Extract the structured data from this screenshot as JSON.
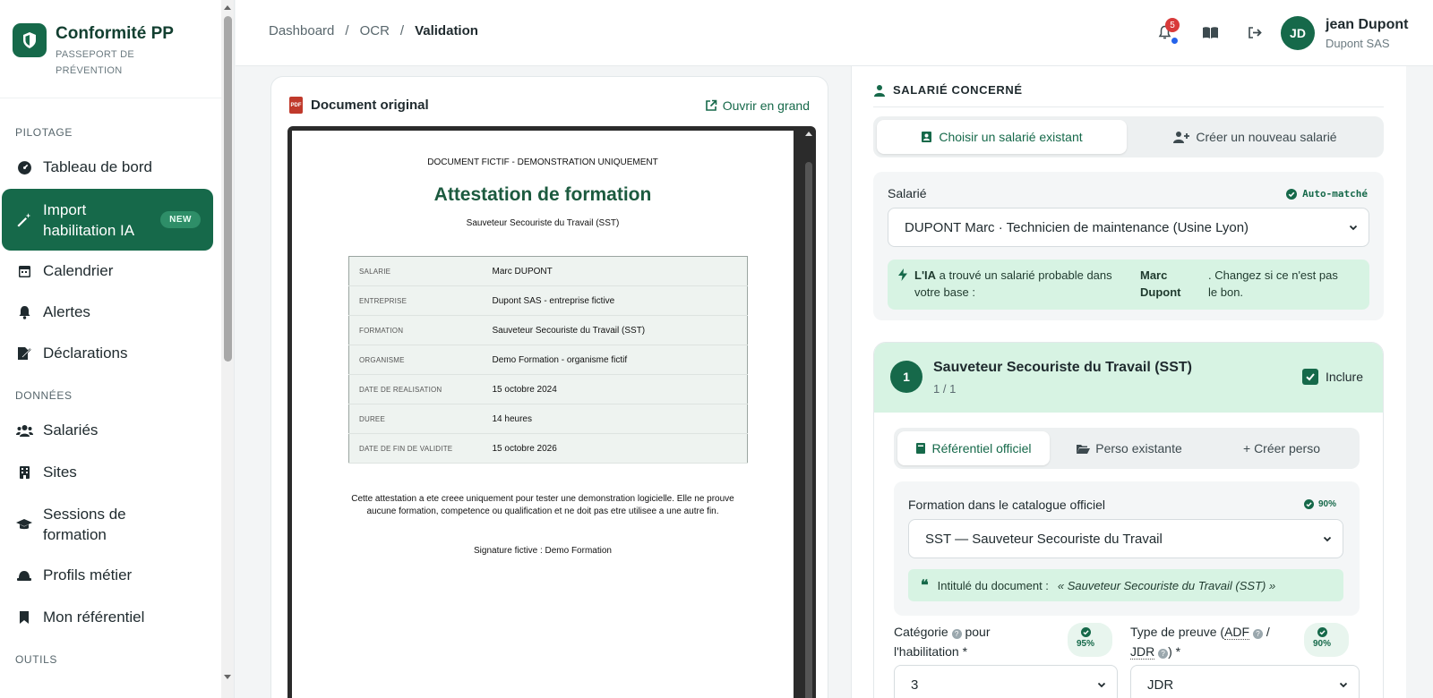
{
  "brand": {
    "title": "Conformité PP",
    "subtitle_line1": "PASSEPORT DE",
    "subtitle_line2": "PRÉVENTION"
  },
  "nav": {
    "section_pilotage": "PILOTAGE",
    "section_donnees": "DONNÉES",
    "section_outils": "OUTILS",
    "tableau": "Tableau de bord",
    "import_line1": "Import",
    "import_line2": "habilitation IA",
    "import_badge": "NEW",
    "calendrier": "Calendrier",
    "alertes": "Alertes",
    "declarations": "Déclarations",
    "salaries": "Salariés",
    "sites": "Sites",
    "sessions_line1": "Sessions de",
    "sessions_line2": "formation",
    "profils": "Profils métier",
    "referentiel": "Mon référentiel"
  },
  "header": {
    "breadcrumb": [
      "Dashboard",
      "/",
      "OCR",
      "/",
      "Validation"
    ],
    "notif_count": "5",
    "user_initials": "JD",
    "user_name": "jean Dupont",
    "user_company": "Dupont SAS"
  },
  "doc": {
    "title": "Document original",
    "open_big": "Ouvrir en grand",
    "pdf_label": "PDF",
    "fictitious": "DOCUMENT FICTIF - DEMONSTRATION UNIQUEMENT",
    "heading": "Attestation de formation",
    "subheading": "Sauveteur Secouriste du Travail (SST)",
    "rows": [
      {
        "k": "SALARIE",
        "v": "Marc DUPONT"
      },
      {
        "k": "ENTREPRISE",
        "v": "Dupont SAS - entreprise fictive"
      },
      {
        "k": "FORMATION",
        "v": "Sauveteur Secouriste du Travail (SST)"
      },
      {
        "k": "ORGANISME",
        "v": "Demo Formation - organisme fictif"
      },
      {
        "k": "DATE DE REALISATION",
        "v": "15 octobre 2024"
      },
      {
        "k": "DUREE",
        "v": "14 heures"
      },
      {
        "k": "DATE DE FIN DE VALIDITE",
        "v": "15 octobre 2026"
      }
    ],
    "disclaimer_line1": "Cette attestation a ete creee uniquement pour tester une demonstration logicielle. Elle ne prouve",
    "disclaimer_line2": "aucune formation, competence ou qualification et ne doit pas etre utilisee a une autre fin.",
    "signature": "Signature fictive : Demo Formation"
  },
  "employee": {
    "section_title": "SALARIÉ CONCERNÉ",
    "tab_existing": "Choisir un salarié existant",
    "tab_new": "Créer un nouveau salarié",
    "label": "Salarié",
    "auto_match": "Auto-matché",
    "selected": "DUPONT Marc · Technicien de maintenance (Usine Lyon)",
    "ai_prefix": "L'IA",
    "ai_text_1": "a trouvé un salarié probable dans",
    "ai_text_2": "votre base :",
    "ai_name_1": "Marc",
    "ai_name_2": "Dupont",
    "ai_suffix_1": ". Changez si ce n'est pas",
    "ai_suffix_2": "le bon."
  },
  "training": {
    "number": "1",
    "title": "Sauveteur Secouriste du Travail (SST)",
    "counter": "1 / 1",
    "include_label": "Inclure",
    "include_checked": true,
    "tab_official": "Référentiel officiel",
    "tab_existing": "Perso existante",
    "tab_create": "+ Créer perso",
    "catalog_label": "Formation dans le catalogue officiel",
    "catalog_pct": "90%",
    "catalog_selected": "SST — Sauveteur Secouriste du Travail",
    "doc_title_label": "Intitulé du document :",
    "doc_title_value": "« Sauveteur Secouriste du Travail (SST) »",
    "category_label_1": "Catégorie",
    "category_label_2": "pour",
    "category_label_3": "l'habilitation *",
    "category_pct": "95%",
    "category_value": "3",
    "proof_label_1": "Type de preuve (",
    "proof_label_adf": "ADF",
    "proof_label_2": "/",
    "proof_label_jdr": "JDR",
    "proof_label_3": ") *",
    "proof_pct": "90%",
    "proof_value": "JDR"
  },
  "colors": {
    "brand": "#16694a",
    "mint": "#d7f3e3",
    "badge_red": "#d83a3a"
  }
}
